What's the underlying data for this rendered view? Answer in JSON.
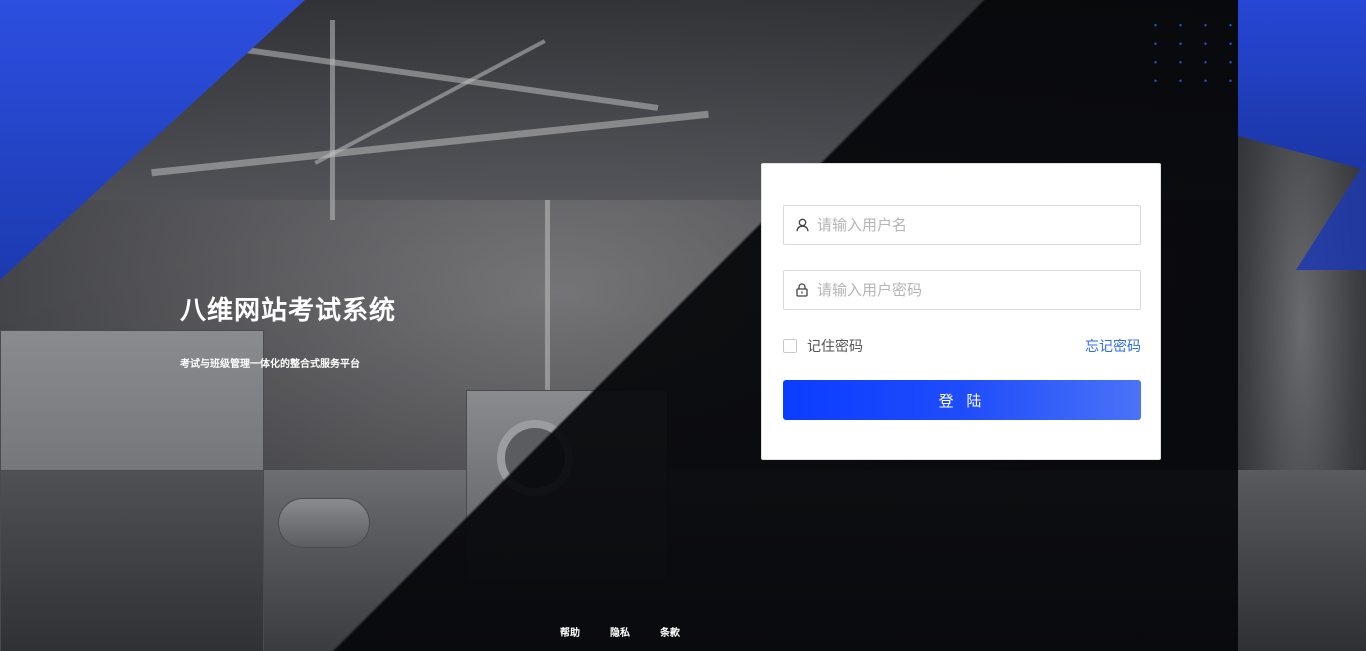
{
  "brand": {
    "title": "八维网站考试系统",
    "subtitle": "考试与班级管理一体化的整合式服务平台"
  },
  "login": {
    "username_placeholder": "请输入用户名",
    "password_placeholder": "请输入用户密码",
    "username_icon": "user-icon",
    "password_icon": "lock-icon",
    "remember_label": "记住密码",
    "forgot_label": "忘记密码",
    "submit_label": "登 陆"
  },
  "footer": {
    "links": [
      "帮助",
      "隐私",
      "条款"
    ]
  },
  "colors": {
    "accent": "#1f4cfb",
    "link": "#2e6cf0",
    "brand_blue": "#2d4fe0"
  }
}
